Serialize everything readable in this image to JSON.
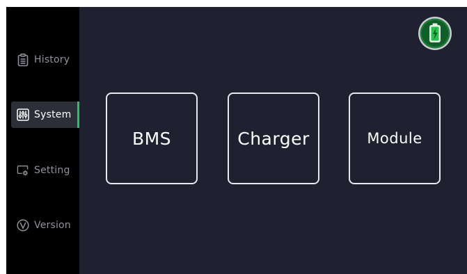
{
  "sidebar": {
    "items": [
      {
        "label": "History",
        "icon": "clipboard-icon",
        "active": false
      },
      {
        "label": "System",
        "icon": "sliders-icon",
        "active": true
      },
      {
        "label": "Setting",
        "icon": "settings-gear-icon",
        "active": false
      },
      {
        "label": "Version",
        "icon": "v-circle-icon",
        "active": false
      }
    ]
  },
  "main": {
    "tiles": [
      {
        "label": "BMS"
      },
      {
        "label": "Charger"
      },
      {
        "label": "Module"
      }
    ],
    "battery_status": "battery-charging-icon"
  },
  "colors": {
    "sidebar_bg": "#000000",
    "main_bg": "#1f2130",
    "accent": "#22c55e",
    "tile_border": "#e8e9ee",
    "inactive_text": "#8f929a"
  }
}
